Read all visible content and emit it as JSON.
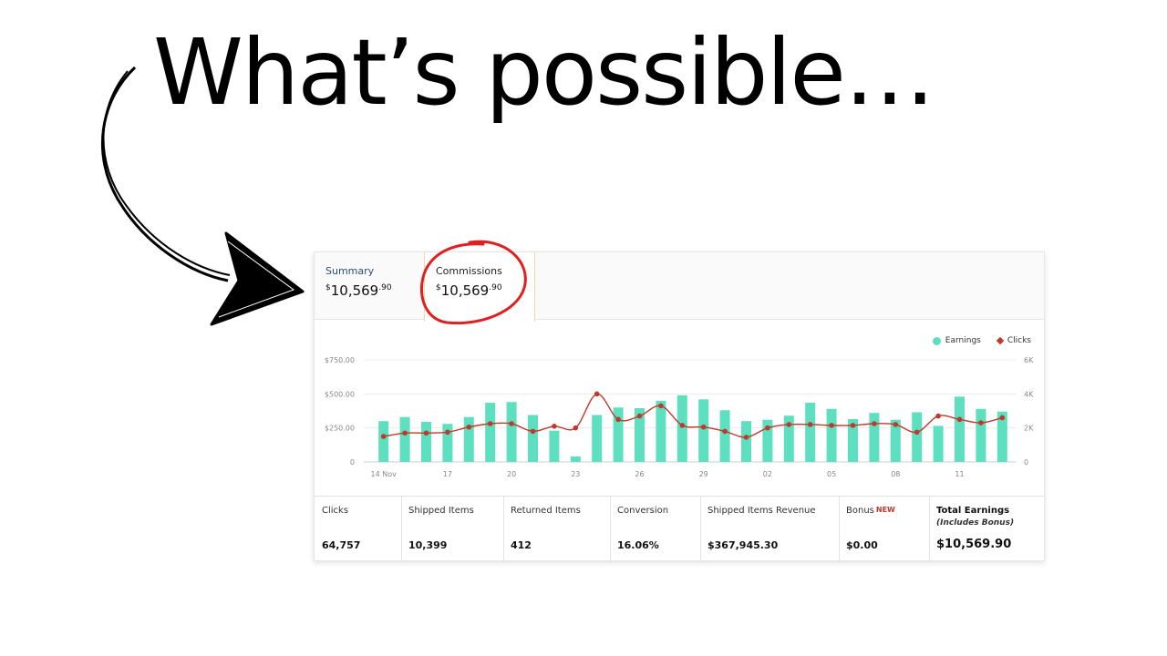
{
  "headline": "What’s possible…",
  "tabs": {
    "summary": {
      "label": "Summary",
      "currency": "$",
      "whole": "10,569",
      "cents": ".90"
    },
    "commissions": {
      "label": "Commissions",
      "currency": "$",
      "whole": "10,569",
      "cents": ".90"
    }
  },
  "legend": {
    "earnings": "Earnings",
    "clicks": "Clicks"
  },
  "colors": {
    "earnings": "#5de0c0",
    "clicks": "#c0392b",
    "annotation": "#e02020"
  },
  "chart_data": {
    "type": "bar",
    "left_axis_ticks": [
      "0",
      "$250.00",
      "$500.00",
      "$750.00"
    ],
    "right_axis_ticks": [
      "0",
      "2K",
      "4K",
      "6K"
    ],
    "x_tick_labels": [
      "14 Nov",
      "17",
      "20",
      "23",
      "26",
      "29",
      "02",
      "05",
      "08",
      "11"
    ],
    "ylim_left": [
      0,
      750
    ],
    "ylim_right": [
      0,
      6000
    ],
    "series": [
      {
        "name": "Earnings",
        "axis": "left",
        "values": [
          300,
          330,
          295,
          280,
          330,
          435,
          440,
          345,
          230,
          40,
          345,
          400,
          395,
          450,
          490,
          460,
          380,
          300,
          310,
          340,
          435,
          390,
          315,
          360,
          310,
          365,
          265,
          480,
          390,
          370
        ]
      },
      {
        "name": "Clicks",
        "axis": "right",
        "values": [
          1500,
          1700,
          1700,
          1750,
          2050,
          2250,
          2250,
          1800,
          2100,
          2000,
          4000,
          2500,
          2700,
          3300,
          2150,
          2050,
          1800,
          1450,
          2000,
          2200,
          2200,
          2150,
          2150,
          2250,
          2200,
          1750,
          2700,
          2500,
          2300,
          2600
        ]
      }
    ]
  },
  "stats": [
    {
      "label": "Clicks",
      "value": "64,757"
    },
    {
      "label": "Shipped Items",
      "value": "10,399"
    },
    {
      "label": "Returned Items",
      "value": "412"
    },
    {
      "label": "Conversion",
      "value": "16.06%"
    },
    {
      "label": "Shipped Items Revenue",
      "value": "$367,945.30"
    },
    {
      "label": "Bonus",
      "badge": "NEW",
      "value": "$0.00"
    },
    {
      "label": "Total Earnings",
      "sub": "(Includes Bonus)",
      "value": "$10,569.90"
    }
  ]
}
